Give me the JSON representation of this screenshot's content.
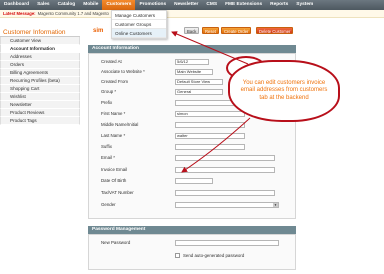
{
  "nav": {
    "items": [
      "Dashboard",
      "Sales",
      "Catalog",
      "Mobile",
      "Customers",
      "Promotions",
      "Newsletter",
      "CMS",
      "FME Extensions",
      "Reports",
      "System"
    ],
    "active_index": 4
  },
  "message": {
    "label": "Latest Message:",
    "text": "Magento Community 1.7 and Magento"
  },
  "customers_menu": [
    "Manage Customers",
    "Customer Groups",
    "Online Customers"
  ],
  "sidebar": {
    "title": "Customer Information",
    "items": [
      "Customer View",
      "Account Information",
      "Addresses",
      "Orders",
      "Billing Agreements",
      "Recurring Profiles (beta)",
      "Shopping Cart",
      "Wishlist",
      "Newsletter",
      "Product Reviews",
      "Product Tags"
    ],
    "active_index": 1
  },
  "toolbar": {
    "page_title": "sim",
    "back": "Back",
    "reset": "Reset",
    "create_order": "Create Order",
    "delete_customer": "Delete Customer"
  },
  "account": {
    "header": "Account Information",
    "fields": [
      {
        "label": "Created At",
        "value": "5/6/12"
      },
      {
        "label": "Associate to Website *",
        "value": "Main Website"
      },
      {
        "label": "Created From",
        "value": "Default Store View"
      },
      {
        "label": "Group *",
        "value": "General"
      },
      {
        "label": "Prefix",
        "value": ""
      },
      {
        "label": "First Name *",
        "value": "simon"
      },
      {
        "label": "Middle Name/Initial",
        "value": ""
      },
      {
        "label": "Last Name *",
        "value": "walter"
      },
      {
        "label": "Suffix",
        "value": ""
      },
      {
        "label": "Email *",
        "value": ""
      },
      {
        "label": "Invoice Email",
        "value": ""
      },
      {
        "label": "Date Of Birth",
        "value": ""
      },
      {
        "label": "Tax/VAT Number",
        "value": ""
      },
      {
        "label": "Gender",
        "value": ""
      }
    ]
  },
  "password": {
    "header": "Password Management",
    "new_password_label": "New Password",
    "autogen_label": "Send auto-generated password"
  },
  "callout": {
    "text": "You can edit customers invoice email addresses from customers tab at the backend"
  },
  "colors": {
    "accent": "#eb5e00",
    "callout_border": "#b80f1a",
    "callout_text": "#f0730c",
    "header_bar": "#6f8992"
  }
}
